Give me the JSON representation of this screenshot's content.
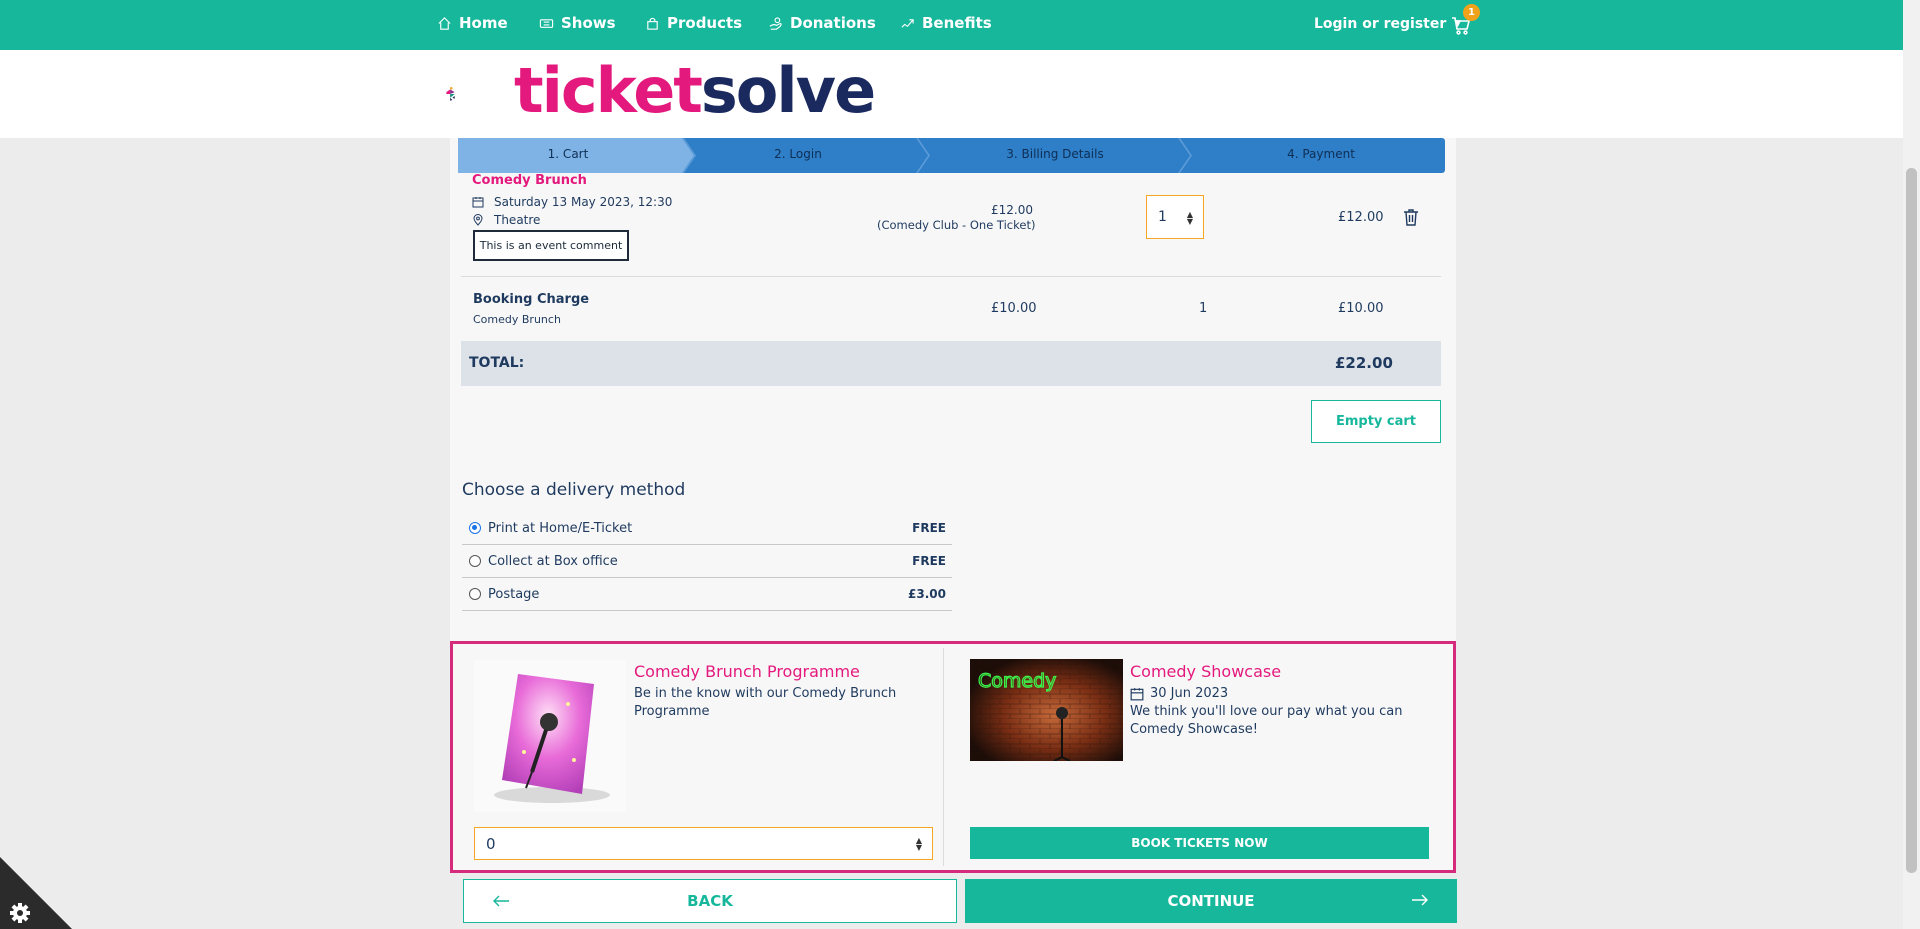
{
  "nav": {
    "items": [
      {
        "label": "Home",
        "icon": "home-icon"
      },
      {
        "label": "Shows",
        "icon": "ticket-icon"
      },
      {
        "label": "Products",
        "icon": "bag-icon"
      },
      {
        "label": "Donations",
        "icon": "donation-icon"
      },
      {
        "label": "Benefits",
        "icon": "benefits-icon"
      }
    ],
    "login_label": "Login or register",
    "cart_count": "1"
  },
  "brand": {
    "logo_part1": "ticket",
    "logo_part2": "solve",
    "colors": {
      "teal": "#17b79c",
      "pink": "#e4197d",
      "navy": "#1b2a5e",
      "step_active": "#7fb3e6",
      "step_inactive": "#2e7ec8"
    }
  },
  "steps": [
    "1. Cart",
    "2. Login",
    "3. Billing Details",
    "4. Payment"
  ],
  "cart": {
    "item": {
      "title": "Comedy Brunch",
      "date": "Saturday 13 May 2023, 12:30",
      "venue": "Theatre",
      "comment": "This is an event comment",
      "price": "£12.00",
      "price_note": "(Comedy Club - One Ticket)",
      "quantity": "1",
      "line_total": "£12.00"
    },
    "booking_charge": {
      "title": "Booking Charge",
      "subtitle": "Comedy Brunch",
      "price": "£10.00",
      "quantity": "1",
      "line_total": "£10.00"
    },
    "total_label": "TOTAL:",
    "total_value": "£22.00",
    "empty_cart_label": "Empty cart"
  },
  "delivery": {
    "title": "Choose a delivery method",
    "options": [
      {
        "label": "Print at Home/E-Ticket",
        "price": "FREE",
        "selected": true
      },
      {
        "label": "Collect at Box office",
        "price": "FREE",
        "selected": false
      },
      {
        "label": "Postage",
        "price": "£3.00",
        "selected": false
      }
    ]
  },
  "upsell": {
    "product": {
      "title": "Comedy Brunch Programme",
      "description": "Be in the know with our Comedy Brunch Programme",
      "quantity": "0"
    },
    "event": {
      "title": "Comedy Showcase",
      "date": "30 Jun 2023",
      "description": "We think you'll love our pay what you can Comedy Showcase!",
      "image_text": "Comedy",
      "button_label": "BOOK TICKETS NOW"
    }
  },
  "footer_nav": {
    "back_label": "BACK",
    "continue_label": "CONTINUE"
  }
}
